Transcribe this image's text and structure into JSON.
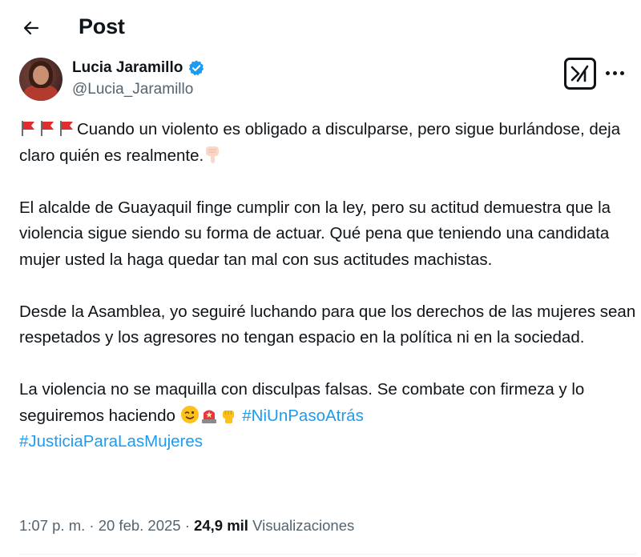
{
  "header": {
    "title": "Post"
  },
  "author": {
    "display_name": "Lucia Jaramillo",
    "handle": "@Lucia_Jaramillo"
  },
  "tweet": {
    "p1_text": "Cuando un violento es obligado a disculparse, pero sigue burlándose, deja claro quién es realmente.",
    "p2_text": "El alcalde de Guayaquil finge cumplir con la ley, pero su actitud demuestra que la violencia sigue siendo su forma de actuar. Qué pena que teniendo una candidata mujer usted la haga quedar tan mal con sus actitudes machistas.",
    "p3_text": "Desde la Asamblea, yo seguiré luchando para que los derechos de las mujeres sean respetados y los agresores no tengan espacio en la política ni en la sociedad.",
    "p4_text": "La violencia no se maquilla con disculpas falsas. Se combate con firmeza y lo seguiremos haciendo",
    "hashtag1": "#NiUnPasoAtrás",
    "hashtag2": "#JusticiaParaLasMujeres"
  },
  "meta": {
    "time": "1:07 p. m.",
    "separator": " · ",
    "date": "20 feb. 2025",
    "separator2": " · ",
    "views_count": "24,9 mil",
    "views_label": "Visualizaciones"
  },
  "icons": {
    "back": "back-arrow-icon",
    "verified": "verified-badge-icon",
    "grok": "grok-icon",
    "more": "more-horizontal-icon",
    "flag": "red-flag-emoji",
    "pointing": "pointing-down-emoji",
    "wink": "winking-face-emoji",
    "siren": "police-light-emoji",
    "fist": "raised-fist-emoji"
  },
  "colors": {
    "link": "#1d9bf0",
    "verified": "#1d9bf0",
    "secondary_text": "#536471",
    "primary_text": "#0f1419"
  }
}
